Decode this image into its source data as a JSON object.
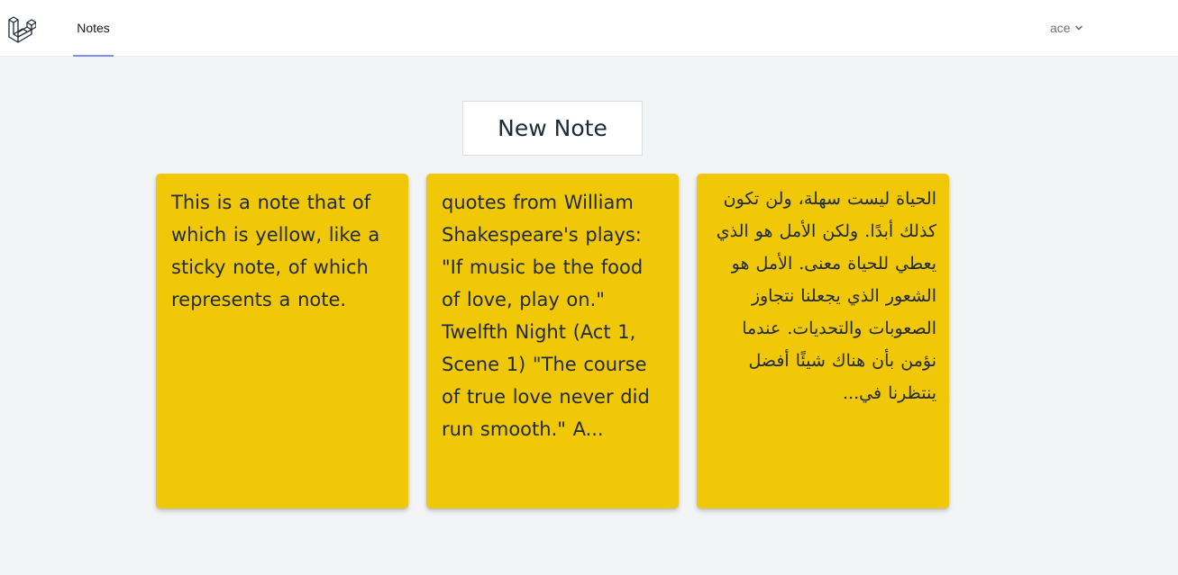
{
  "navbar": {
    "logo_icon": "laravel-logo-icon",
    "nav_link": "Notes",
    "user_name": "ace",
    "user_menu_icon": "chevron-down-icon",
    "active_underline_color": "#818cf8"
  },
  "main": {
    "new_note_label": "New Note",
    "note_color": "#f0c808",
    "notes": [
      {
        "text": "This is a note that of which is yellow, like a sticky note, of which represents a note."
      },
      {
        "text": "quotes from William Shakespeare's plays: \"If music be the food of love, play on.\" Twelfth Night (Act 1, Scene 1) \"The course of true love never did run smooth.\" A..."
      },
      {
        "text": "الحياة ليست سهلة، ولن تكون كذلك أبدًا. ولكن الأمل هو الذي يعطي للحياة معنى. الأمل هو الشعور الذي يجعلنا نتجاوز الصعوبات والتحديات. عندما نؤمن بأن هناك شيئًا أفضل ينتظرنا في..."
      }
    ]
  }
}
